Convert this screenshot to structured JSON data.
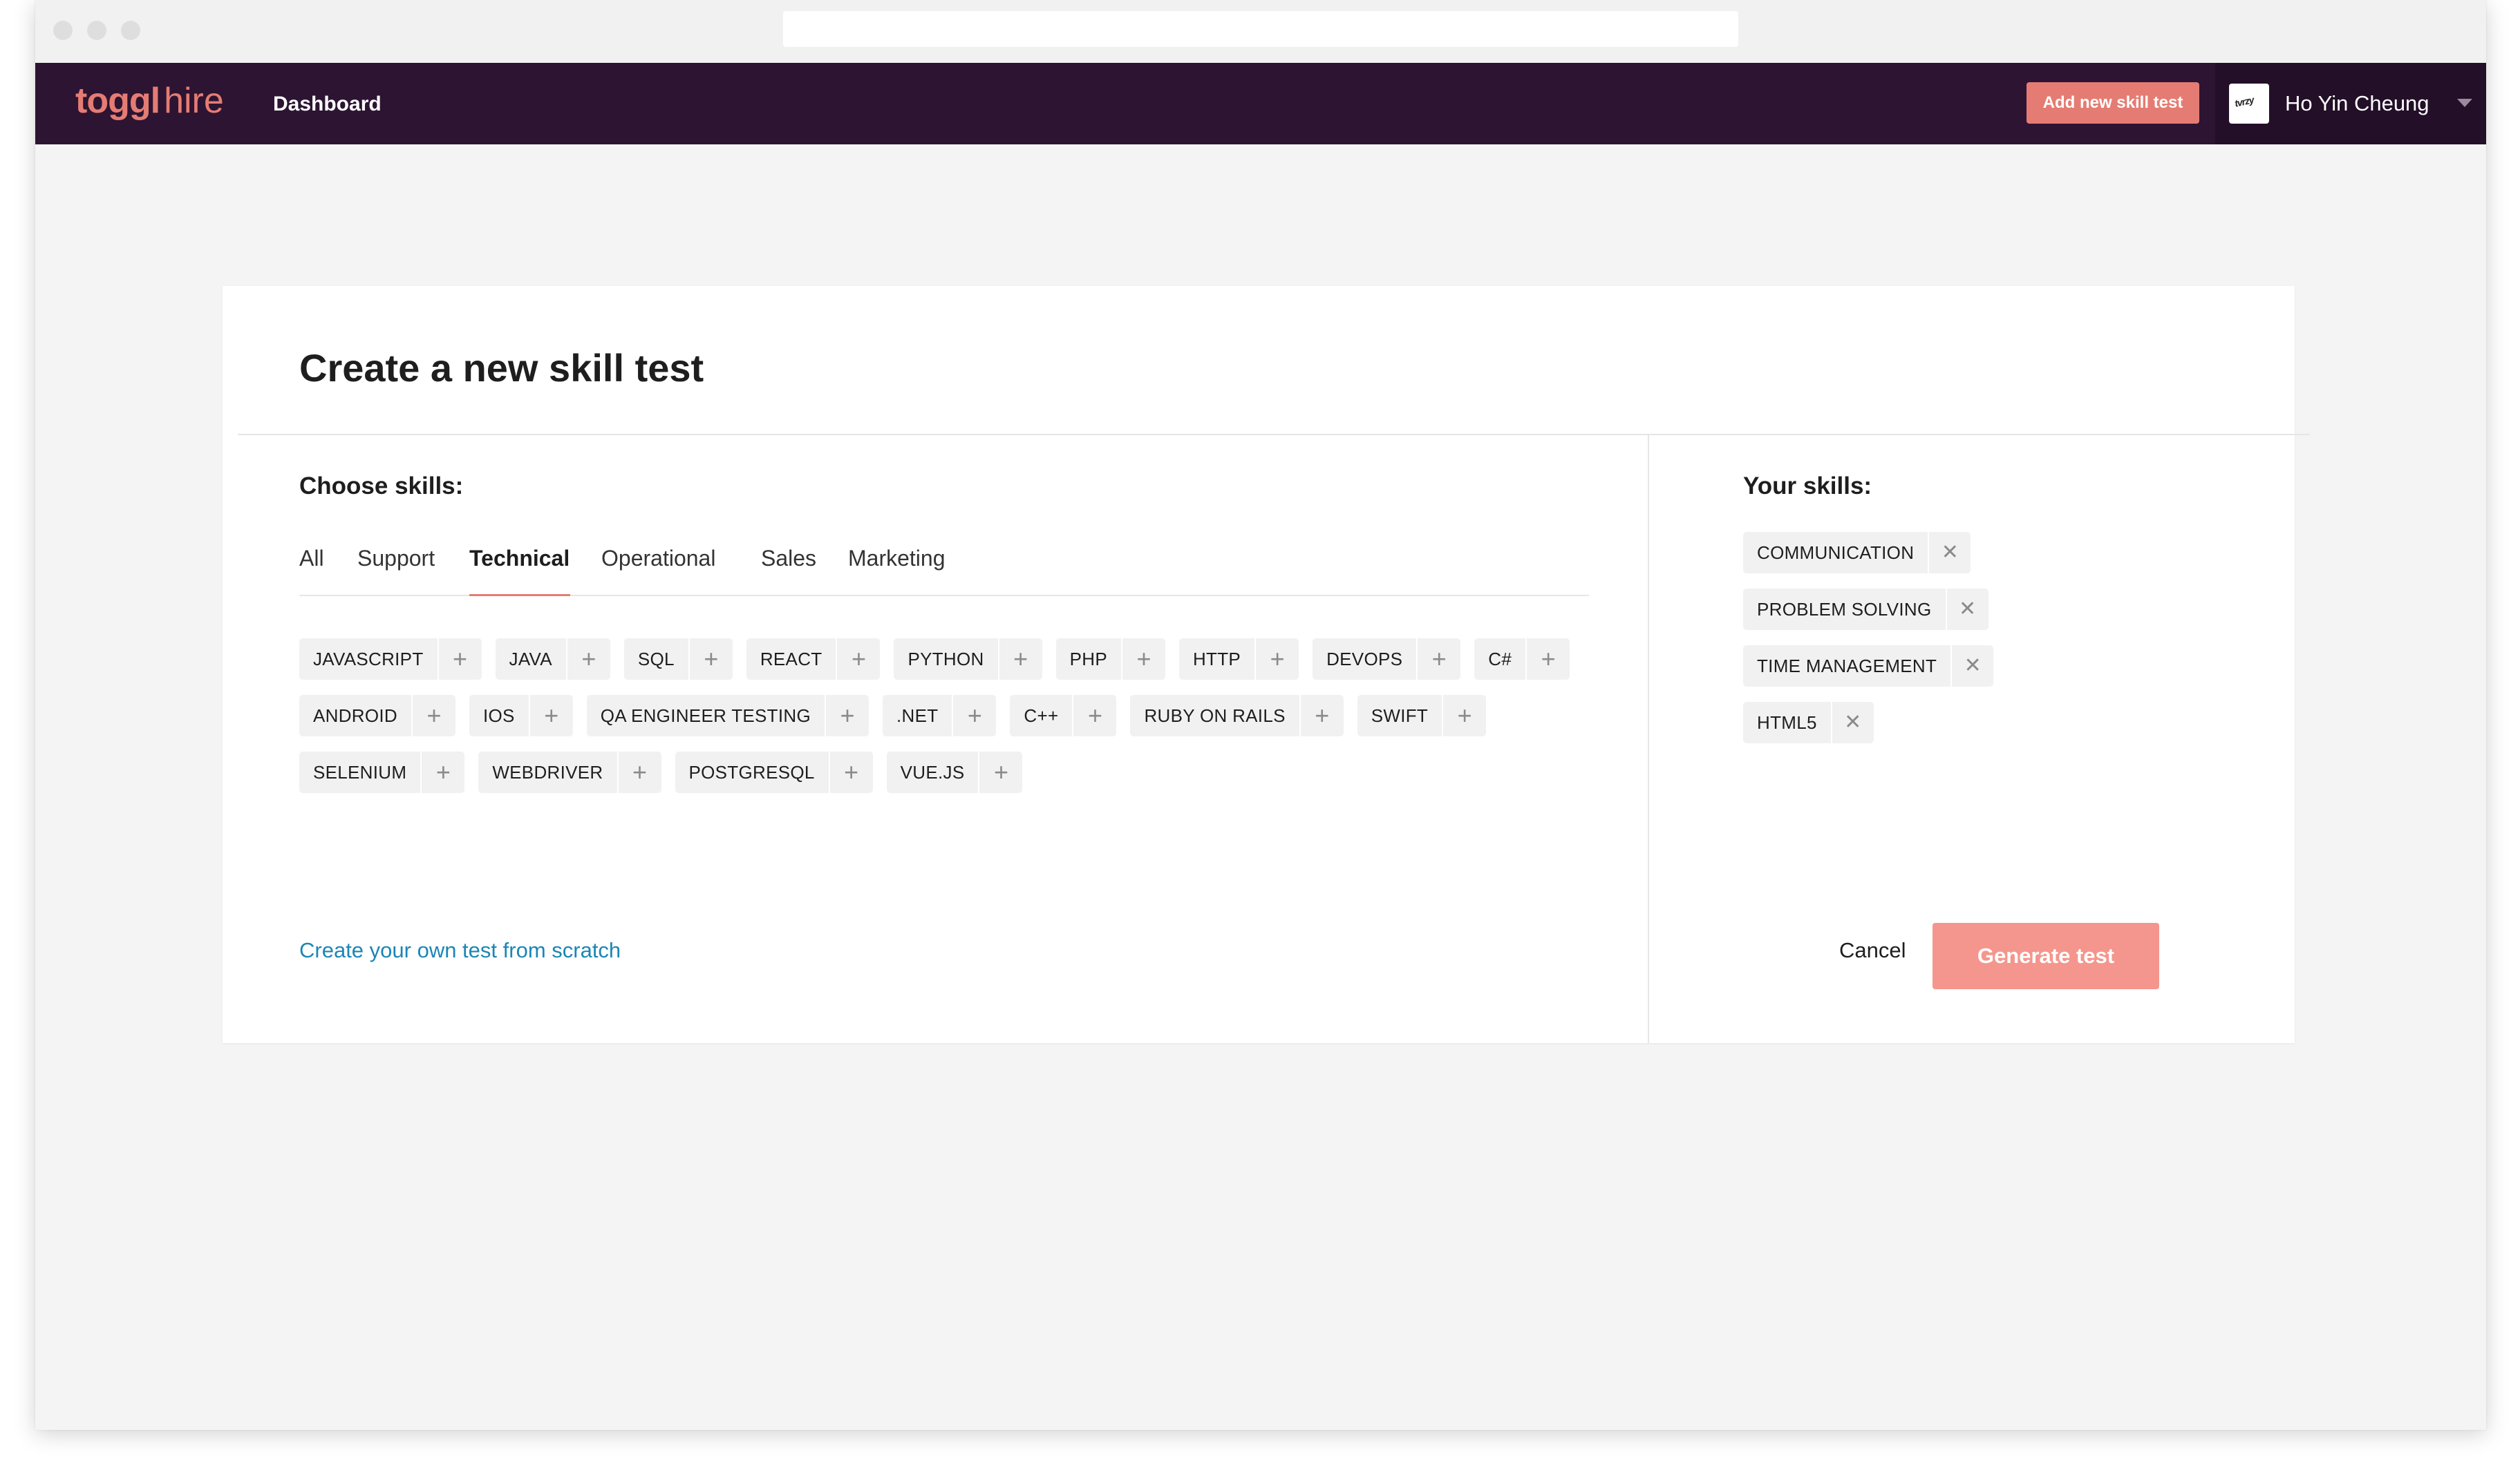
{
  "app": {
    "logo_primary": "toggl",
    "logo_secondary": "hire",
    "nav": {
      "dashboard": "Dashboard"
    },
    "add_button": "Add new skill test",
    "user": {
      "name": "Ho Yin Cheung",
      "avatar_text": "tvrzy"
    }
  },
  "page": {
    "title": "Create a new skill test",
    "choose_label": "Choose skills:",
    "your_label": "Your skills:",
    "tabs": [
      {
        "label": "All"
      },
      {
        "label": "Support"
      },
      {
        "label": "Technical",
        "active": true
      },
      {
        "label": "Operational"
      },
      {
        "label": "Sales"
      },
      {
        "label": "Marketing"
      }
    ],
    "available_skills": [
      [
        "JAVASCRIPT",
        "JAVA",
        "SQL",
        "REACT",
        "PYTHON",
        "PHP",
        "HTTP",
        "DEVOPS",
        "C#"
      ],
      [
        "ANDROID",
        "IOS",
        "QA ENGINEER TESTING",
        ".NET",
        "C++",
        "RUBY ON RAILS",
        "SWIFT"
      ],
      [
        "SELENIUM",
        "WEBDRIVER",
        "POSTGRESQL",
        "VUE.JS"
      ]
    ],
    "selected_skills": [
      "COMMUNICATION",
      "PROBLEM SOLVING",
      "TIME MANAGEMENT",
      "HTML5"
    ],
    "scratch_link": "Create your own test from scratch",
    "cancel_button": "Cancel",
    "generate_button": "Generate test"
  },
  "colors": {
    "accent": "#e57c73",
    "app_bar": "#2d1432",
    "link": "#1b86b5",
    "generate": "#f4968d"
  },
  "icons": {
    "add": "plus-icon",
    "remove": "close-icon",
    "menu": "chevron-down-icon"
  }
}
